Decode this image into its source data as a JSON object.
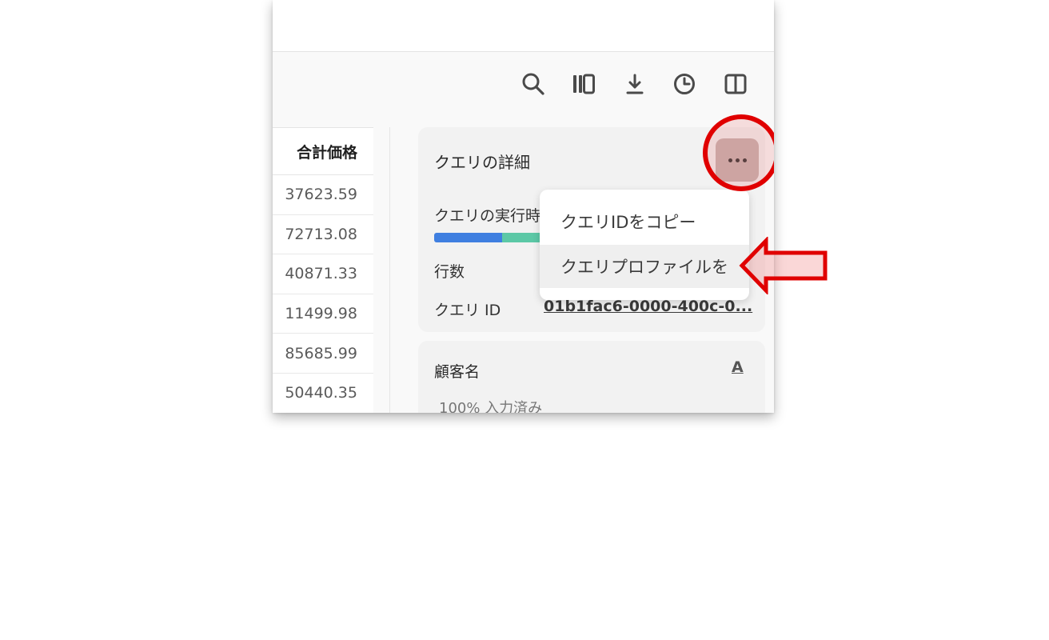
{
  "toolbar": {
    "icons": [
      "search-icon",
      "columns-icon",
      "download-icon",
      "history-icon",
      "panel-toggle-icon"
    ]
  },
  "table": {
    "header": "合計価格",
    "rows": [
      "37623.59",
      "72713.08",
      "40871.33",
      "11499.98",
      "85685.99",
      "50440.35"
    ]
  },
  "details": {
    "title": "クエリの詳細",
    "exec_label": "クエリの実行時",
    "rows_label": "行数",
    "query_id_label": "クエリ ID",
    "query_id_value": "01b1fac6-0000-400c-0..."
  },
  "menu": {
    "copy_id": "クエリIDをコピー",
    "view_profile": "クエリプロファイルを"
  },
  "column_card": {
    "title": "顧客名",
    "type_icon": "A",
    "fill_rate": "100% 入力済み"
  },
  "colors": {
    "highlight_red": "#e00000",
    "bar_blue": "#3f7fe0",
    "bar_teal": "#5cc8a6"
  }
}
